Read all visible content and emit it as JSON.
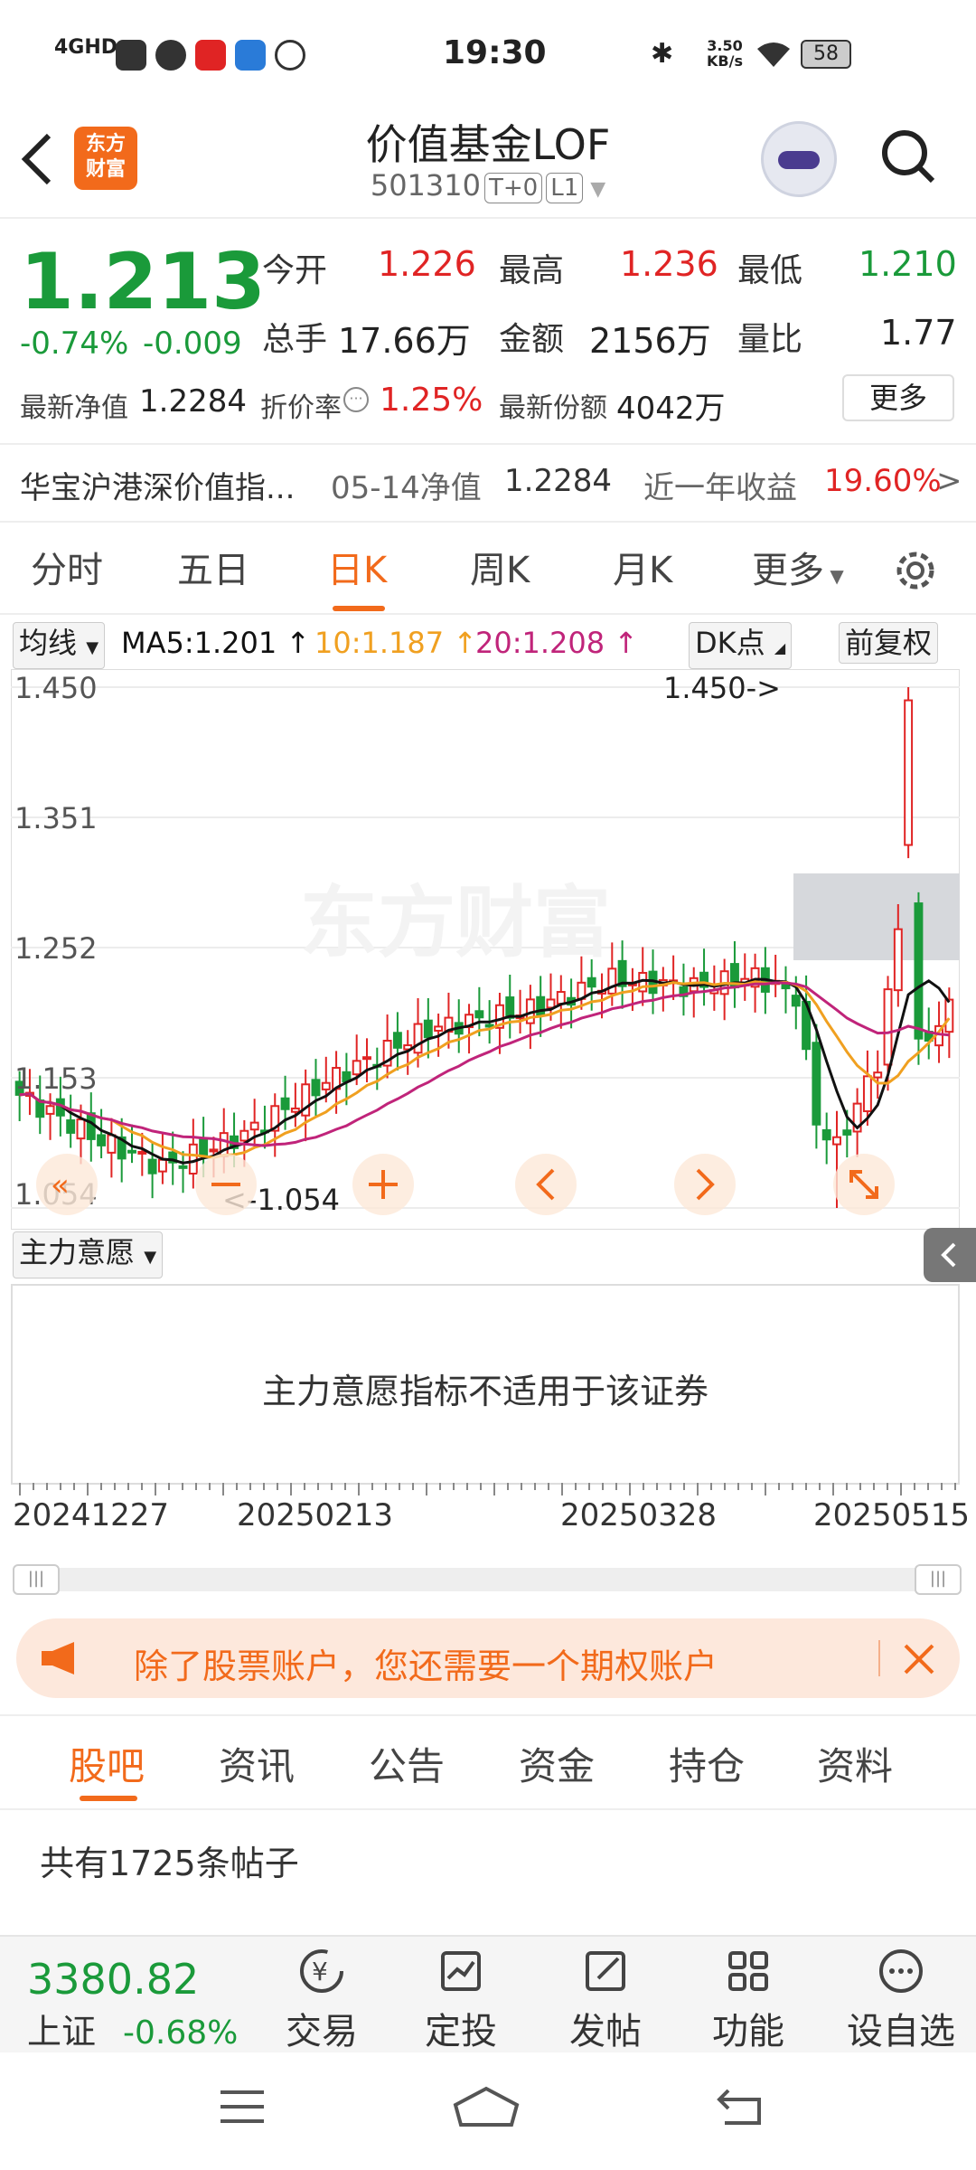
{
  "status": {
    "time": "19:30",
    "network": "4GHD",
    "speed_value": "3.50",
    "speed_unit": "KB/s",
    "battery": "58"
  },
  "header": {
    "logo_line1": "东方",
    "logo_line2": "财富",
    "title": "价值基金LOF",
    "code": "501310",
    "tag1": "T+0",
    "tag2": "L1"
  },
  "quote": {
    "price": "1.213",
    "change_pct": "-0.74%",
    "change_abs": "-0.009",
    "open_label": "今开",
    "open": "1.226",
    "high_label": "最高",
    "high": "1.236",
    "low_label": "最低",
    "low": "1.210",
    "volume_label": "总手",
    "volume": "17.66万",
    "amount_label": "金额",
    "amount": "2156万",
    "ratio_label": "量比",
    "ratio": "1.77",
    "nav_label": "最新净值",
    "nav": "1.2284",
    "discount_label": "折价率",
    "discount": "1.25%",
    "shares_label": "最新份额",
    "shares": "4042万",
    "more": "更多"
  },
  "index_row": {
    "name": "华宝沪港深价值指...",
    "date_label": "05-14净值",
    "nav": "1.2284",
    "return_label": "近一年收益",
    "return": "19.60%",
    "arrow": ">"
  },
  "chart_tabs": [
    "分时",
    "五日",
    "日K",
    "周K",
    "月K",
    "更多"
  ],
  "ma": {
    "select": "均线",
    "ma5": "MA5:1.201",
    "ma10": "10:1.187",
    "ma20": "20:1.208",
    "dk": "DK点",
    "adjust": "前复权"
  },
  "chart_data": {
    "type": "candlestick",
    "yticks": [
      "1.450",
      "1.351",
      "1.252",
      "1.153",
      "1.054"
    ],
    "ylim": [
      1.054,
      1.45
    ],
    "max_label": "1.450->",
    "min_label": "<-1.054",
    "colors": {
      "up": "#e02424",
      "down": "#1a9a3a",
      "ma5": "#111111",
      "ma10": "#f0a020",
      "ma20": "#c0247a"
    }
  },
  "indicator": {
    "select": "主力意愿",
    "message": "主力意愿指标不适用于该证券"
  },
  "xaxis": [
    "20241227",
    "20250213",
    "20250328",
    "20250515"
  ],
  "banner": {
    "text": "除了股票账户，您还需要一个期权账户"
  },
  "bbs_tabs": [
    "股吧",
    "资讯",
    "公告",
    "资金",
    "持仓",
    "资料"
  ],
  "posts": {
    "count": "共有1725条帖子"
  },
  "toolbar": {
    "index_value": "3380.82",
    "index_name": "上证",
    "index_change": "-0.68%",
    "items": [
      "交易",
      "定投",
      "发帖",
      "功能",
      "设自选"
    ]
  },
  "watermark": "东方财富"
}
